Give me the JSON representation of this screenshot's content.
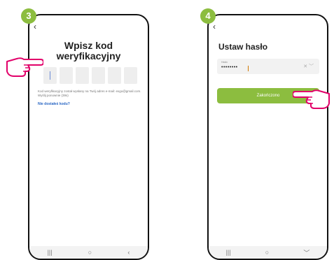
{
  "step1": {
    "number": "3"
  },
  "step2": {
    "number": "4"
  },
  "screen1": {
    "back": "‹",
    "title_line1": "Wpisz kod",
    "title_line2": "weryfikacyjny",
    "info": "Kod weryfikacyjny został wysłany na Twój adres e-mail: exgo@gmail.com. Wyślij ponownie (39s)",
    "link": "Nie dostałeś kodu?"
  },
  "screen2": {
    "back": "‹",
    "title": "Ustaw hasło",
    "field_label": "Hasło",
    "field_value": "••••••••",
    "field_icons": "✕  ﹀",
    "button": "Zakończono"
  },
  "navbar1": {
    "recent": "|||",
    "home": "○",
    "back": "‹"
  },
  "navbar2": {
    "recent": "|||",
    "home": "○",
    "down": "﹀"
  },
  "colors": {
    "accent": "#8cbd3f",
    "link": "#2a67c4"
  }
}
